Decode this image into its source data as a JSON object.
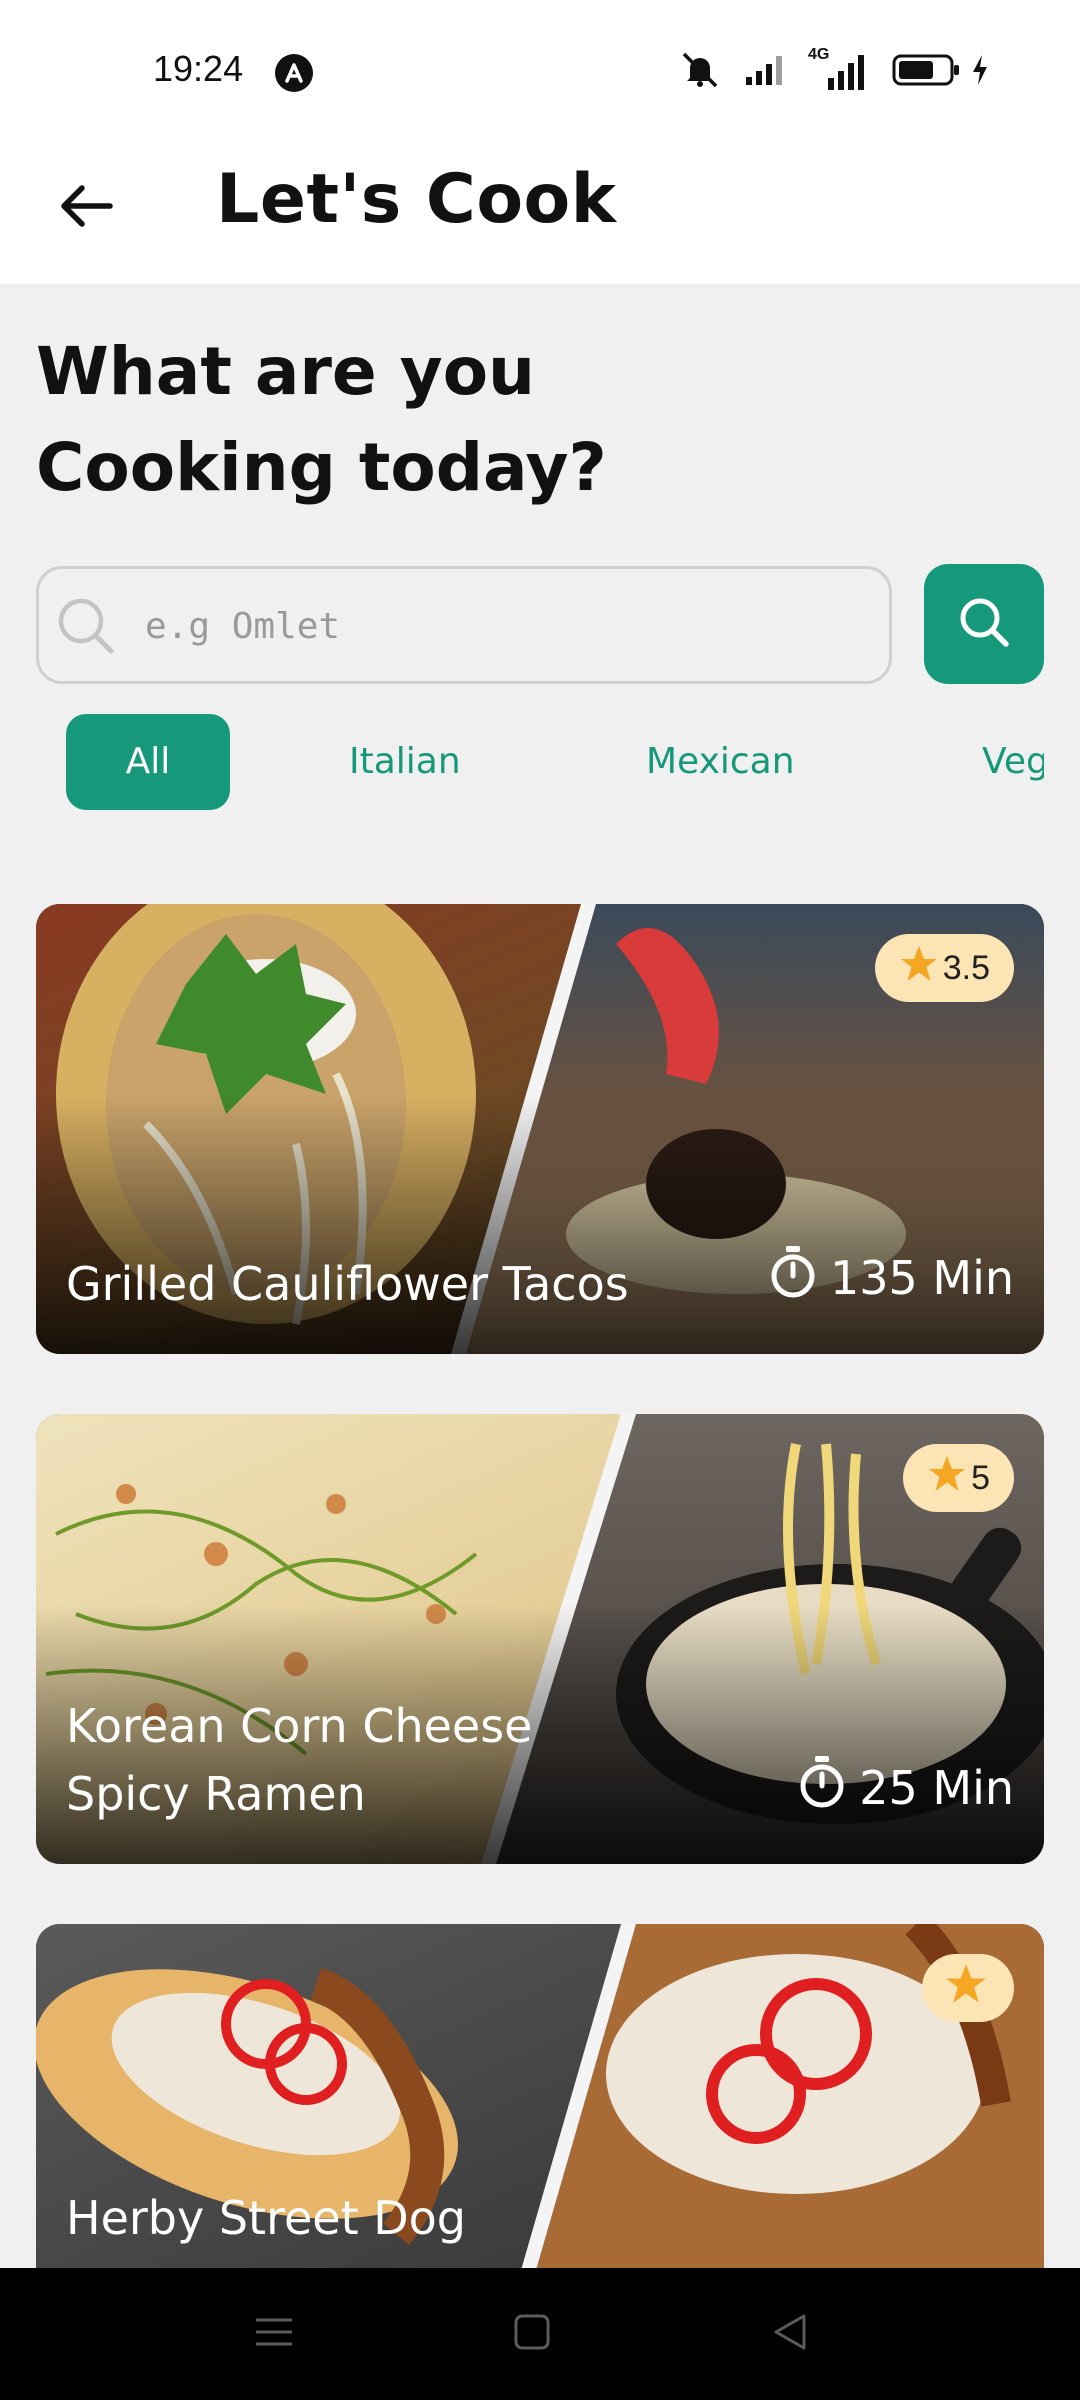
{
  "status_bar": {
    "time": "19:24",
    "network_label": "4G",
    "icons": [
      "app-notification-icon",
      "mute-icon",
      "signal-icon",
      "4g-signal-icon",
      "battery-icon",
      "charging-icon"
    ]
  },
  "header": {
    "title": "Let's Cook",
    "back_icon": "arrow-left-icon"
  },
  "main": {
    "headline_line1": "What are you",
    "headline_line2": "Cooking today?",
    "search": {
      "placeholder": "e.g Omlet",
      "value": ""
    },
    "categories": [
      {
        "label": "All",
        "selected": true
      },
      {
        "label": "Italian",
        "selected": false
      },
      {
        "label": "Mexican",
        "selected": false
      },
      {
        "label": "Veg",
        "selected": false
      }
    ],
    "recipes": [
      {
        "title": "Grilled Cauliflower Tacos",
        "rating": "3.5",
        "time": "135 Min"
      },
      {
        "title": "Korean Corn Cheese Spicy Ramen",
        "rating": "5",
        "time": "25 Min"
      },
      {
        "title": "Herby Street Dog",
        "rating": "",
        "time": ""
      }
    ]
  },
  "colors": {
    "accent": "#16987a",
    "rating_badge": "#fde4b4",
    "star": "#f5a623",
    "background": "#f0f0f0"
  },
  "nav_bar": {
    "icons": [
      "menu-icon",
      "home-square-icon",
      "back-triangle-icon"
    ]
  }
}
